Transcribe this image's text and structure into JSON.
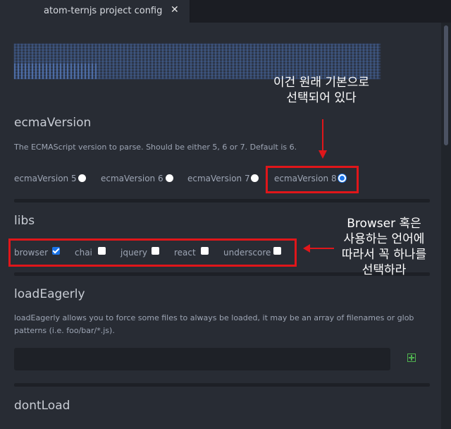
{
  "tab": {
    "title": "atom-ternjs project config",
    "close": "✕"
  },
  "sections": {
    "ecma": {
      "title": "ecmaVersion",
      "description": "The ECMAScript version to parse. Should be either 5, 6 or 7. Default is 6.",
      "options": [
        {
          "label": "ecmaVersion 5",
          "checked": false
        },
        {
          "label": "ecmaVersion 6",
          "checked": false
        },
        {
          "label": "ecmaVersion 7",
          "checked": false
        },
        {
          "label": "ecmaVersion 8",
          "checked": true
        }
      ]
    },
    "libs": {
      "title": "libs",
      "options": [
        {
          "label": "browser",
          "checked": true
        },
        {
          "label": "chai",
          "checked": false
        },
        {
          "label": "jquery",
          "checked": false
        },
        {
          "label": "react",
          "checked": false
        },
        {
          "label": "underscore",
          "checked": false
        }
      ]
    },
    "loadEagerly": {
      "title": "loadEagerly",
      "description": "loadEagerly allows you to force some files to always be loaded, it may be an array of filenames or glob patterns (i.e. foo/bar/*.js).",
      "input_value": ""
    },
    "dontLoad": {
      "title": "dontLoad"
    }
  },
  "annotations": {
    "default_note": "이건 원래 기본으로\n선택되어 있다",
    "libs_note": "Browser 혹은\n사용하는 언어에\n따라서 꼭 하나를\n선택하라"
  },
  "colors": {
    "highlight": "#e0161a",
    "accent": "#1a73e8",
    "add": "#4fb04f"
  }
}
